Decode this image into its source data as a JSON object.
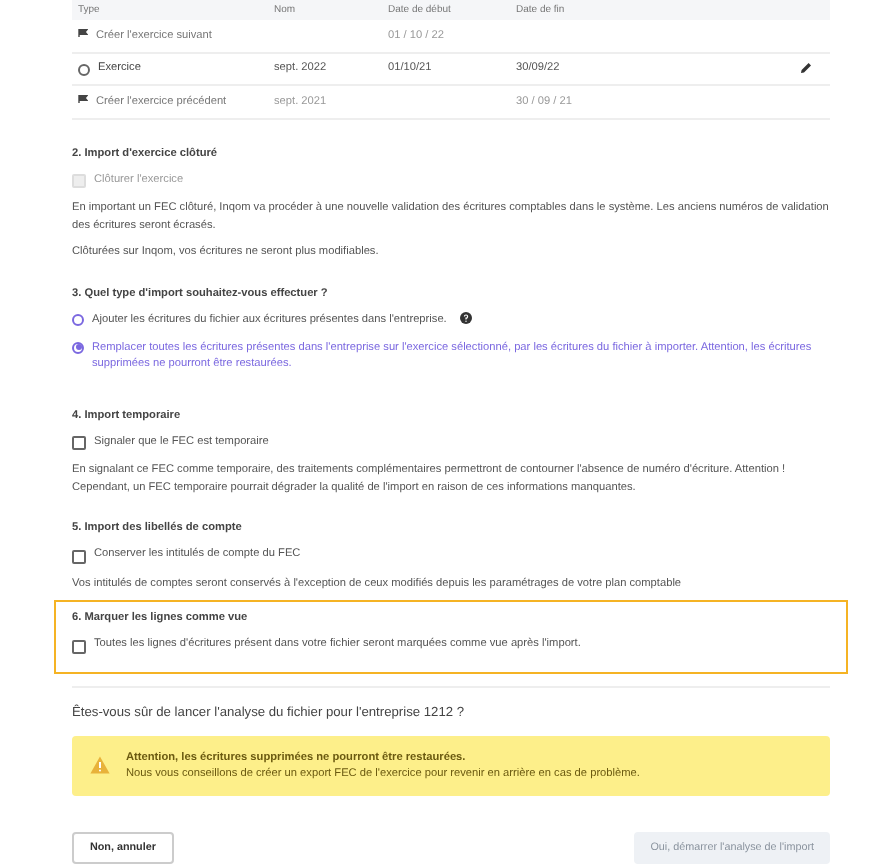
{
  "table": {
    "columns": [
      "Type",
      "Nom",
      "Date de début",
      "Date de fin"
    ],
    "rows": [
      {
        "kind": "action",
        "type": "Créer l'exercice suivant",
        "name": "",
        "start": "01 / 10 / 22",
        "end": ""
      },
      {
        "kind": "exercise",
        "type": "Exercice",
        "selected": false,
        "name": "sept. 2022",
        "start": "01/10/21",
        "end": "30/09/22"
      },
      {
        "kind": "action",
        "type": "Créer l'exercice précédent",
        "name": "sept. 2021",
        "start": "",
        "end": "30 / 09 / 21"
      }
    ]
  },
  "sections": [
    {
      "title": "2. Import d'exercice clôturé",
      "highlighted": false,
      "options": [
        {
          "kind": "checkbox",
          "label": "Clôturer l'exercice",
          "checked": false,
          "disabled": true
        }
      ],
      "paragraphs": [
        "En important un FEC clôturé, Inqom va procéder à une nouvelle validation des écritures comptables dans le système. Les anciens numéros de validation des écritures seront écrasés.",
        "Clôturées sur Inqom, vos écritures ne seront plus modifiables."
      ]
    },
    {
      "title": "3. Quel type d'import souhaitez-vous effectuer ?",
      "highlighted": false,
      "options": [
        {
          "kind": "radio",
          "label": "Ajouter les écritures du fichier aux écritures présentes dans l'entreprise.",
          "selected": false,
          "help": true
        },
        {
          "kind": "radio",
          "label": "Remplacer toutes les écritures présentes dans l'entreprise sur l'exercice sélectionné, par les écritures du fichier à importer. Attention, les écritures supprimées ne pourront être restaurées.",
          "selected": true,
          "help": false
        }
      ]
    },
    {
      "title": "4. Import temporaire",
      "highlighted": false,
      "options": [
        {
          "kind": "checkbox",
          "label": "Signaler que le FEC est temporaire",
          "checked": false,
          "disabled": false
        }
      ],
      "paragraphs": [
        "En signalant ce FEC comme temporaire, des traitements complémentaires permettront de contourner l'absence de numéro d'écriture. Attention ! Cependant, un FEC temporaire pourrait dégrader la qualité de l'import en raison de ces informations manquantes."
      ]
    },
    {
      "title": "5. Import des libellés de compte",
      "highlighted": false,
      "options": [
        {
          "kind": "checkbox",
          "label": "Conserver les intitulés de compte du FEC",
          "checked": false,
          "disabled": false
        }
      ],
      "paragraphs": [
        "Vos intitulés de comptes seront conservés à l'exception de ceux modifiés depuis les paramétrages de votre plan comptable"
      ]
    },
    {
      "title": "6. Marquer les lignes comme vue",
      "highlighted": true,
      "options": [
        {
          "kind": "checkbox",
          "label": "Toutes les lignes d'écritures présent dans votre fichier seront marquées comme vue après l'import.",
          "checked": false,
          "disabled": false
        }
      ]
    }
  ],
  "question": "Êtes-vous sûr de lancer l'analyse du fichier pour l'entreprise 1212 ?",
  "warning": {
    "title": "Attention, les écritures supprimées ne pourront être restaurées.",
    "text": "Nous vous conseillons de créer un export FEC de l'exercice pour revenir en arrière en cas de problème."
  },
  "buttons": [
    {
      "label": "Non, annuler",
      "disabled": false
    },
    {
      "label": "Oui, démarrer l'analyse de l'import",
      "disabled": true
    }
  ]
}
